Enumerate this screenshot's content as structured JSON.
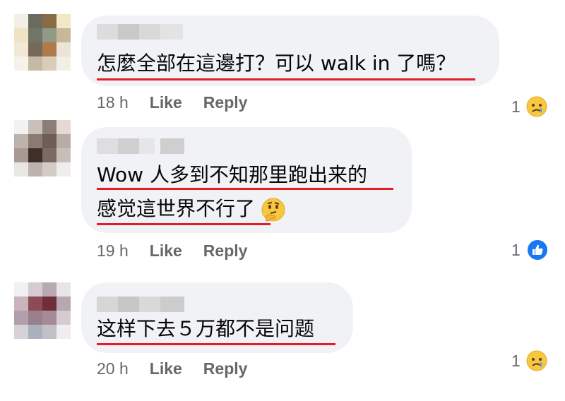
{
  "comments": [
    {
      "text_lines": [
        "怎麼全部在這邊打？可以 walk in 了嗎？"
      ],
      "time": "18 h",
      "like_label": "Like",
      "reply_label": "Reply",
      "reaction_count": "1",
      "reaction_icon": "sad-face-icon",
      "avatar_colors": [
        "#f3efe6",
        "#6b6a5e",
        "#8a6a45",
        "#f2e7c9",
        "#efe3c6",
        "#6f7666",
        "#8f9a87",
        "#c9b79a",
        "#f1e8d6",
        "#756a5a",
        "#b07a4a",
        "#ece4d6",
        "#f6f2ea",
        "#c7b9a3",
        "#d9cdb9",
        "#f4efe6"
      ]
    },
    {
      "text_lines": [
        "Wow 人多到不知那里跑出来的",
        "感觉這世界不行了"
      ],
      "time": "19 h",
      "like_label": "Like",
      "reply_label": "Reply",
      "reaction_count": "1",
      "reaction_icon": "like-thumb-icon",
      "inline_emoji": "thinking-face-icon",
      "avatar_colors": [
        "#f2f2f2",
        "#c9c0bb",
        "#8c7d76",
        "#e3dad5",
        "#bdb3ad",
        "#8a7a72",
        "#6d5d56",
        "#b9aca5",
        "#a79a93",
        "#3e2f2b",
        "#7b6a63",
        "#c8beb8",
        "#e9e6e4",
        "#bdb3ae",
        "#d3cbc6",
        "#f0eeec"
      ]
    },
    {
      "text_lines": [
        "这样下去５万都不是问题"
      ],
      "time": "20 h",
      "like_label": "Like",
      "reply_label": "Reply",
      "reaction_count": "1",
      "reaction_icon": "sad-face-icon",
      "avatar_colors": [
        "#f2f0f2",
        "#d6cad3",
        "#b8a9b3",
        "#e8e4e8",
        "#c9b3bd",
        "#8c4b55",
        "#6e2f3a",
        "#b7a7b0",
        "#b1a0ac",
        "#9b7f8d",
        "#a58b98",
        "#d5ccd2",
        "#d7d2d8",
        "#aab0bd",
        "#c3c0c8",
        "#efedf0"
      ]
    }
  ]
}
